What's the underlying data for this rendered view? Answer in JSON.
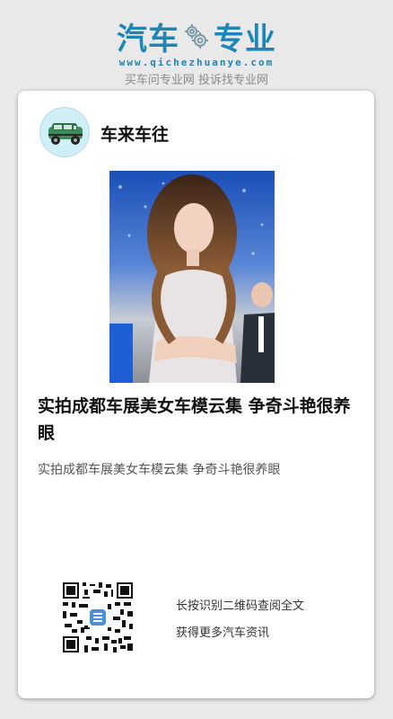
{
  "brand": {
    "logo_left": "汽车",
    "logo_right": "专业",
    "url": "www.qichezhuanye.com",
    "slogan": "买车问专业网 投诉找专业网"
  },
  "colors": {
    "brand_blue": "#1d86b6",
    "page_background": "#e9e9e9",
    "card_background": "#ffffff",
    "avatar_background": "#cfeff6",
    "car_green": "#3d8a5a"
  },
  "account": {
    "avatar_icon": "car-icon",
    "name": "车来车往"
  },
  "article": {
    "image_description_icon": "photo",
    "title": "实拍成都车展美女车模云集 争奇斗艳很养眼",
    "summary": "实拍成都车展美女车模云集 争奇斗艳很养眼"
  },
  "qr": {
    "icon": "qr-code-icon",
    "line1": "长按识别二维码查阅全文",
    "line2": "获得更多汽车资讯"
  }
}
